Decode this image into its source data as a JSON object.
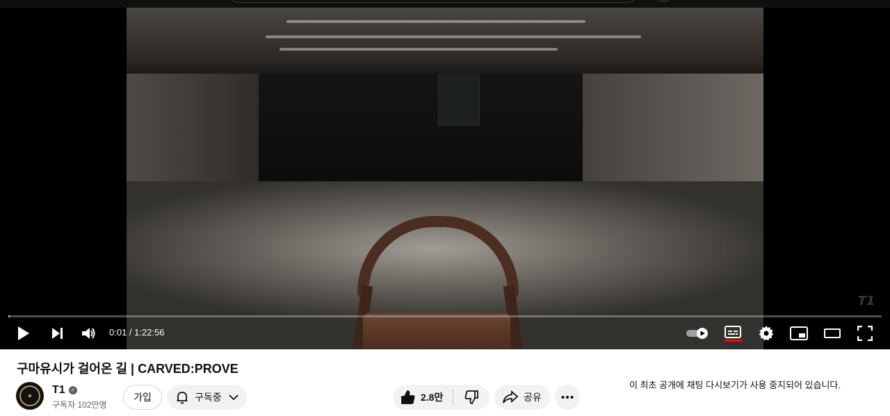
{
  "video": {
    "current_time": "0:01",
    "duration": "1:22:56",
    "time_separator": " / ",
    "progress": 0.0002,
    "watermark_text": "T1"
  },
  "controls": {
    "play": "play-icon",
    "next": "next-icon",
    "volume": "volume-icon",
    "autoplay": "autoplay-toggle-icon",
    "subtitles": "subtitles-icon",
    "settings": "settings-icon",
    "miniplayer": "miniplayer-icon",
    "theater": "theater-mode-icon",
    "fullscreen": "fullscreen-icon",
    "subtitles_active_color": "#ff0000"
  },
  "meta": {
    "title": "구마유시가 걸어온 길 | CARVED:PROVE",
    "channel_name": "T1",
    "subscribers": "구독자 102만명",
    "join_label": "가입",
    "subscribed_label": "구독중",
    "like_count": "2.8만",
    "share_label": "공유"
  },
  "chat": {
    "notice": "이 최초 공개에 채팅 다시보기가 사용 중지되어 있습니다."
  }
}
